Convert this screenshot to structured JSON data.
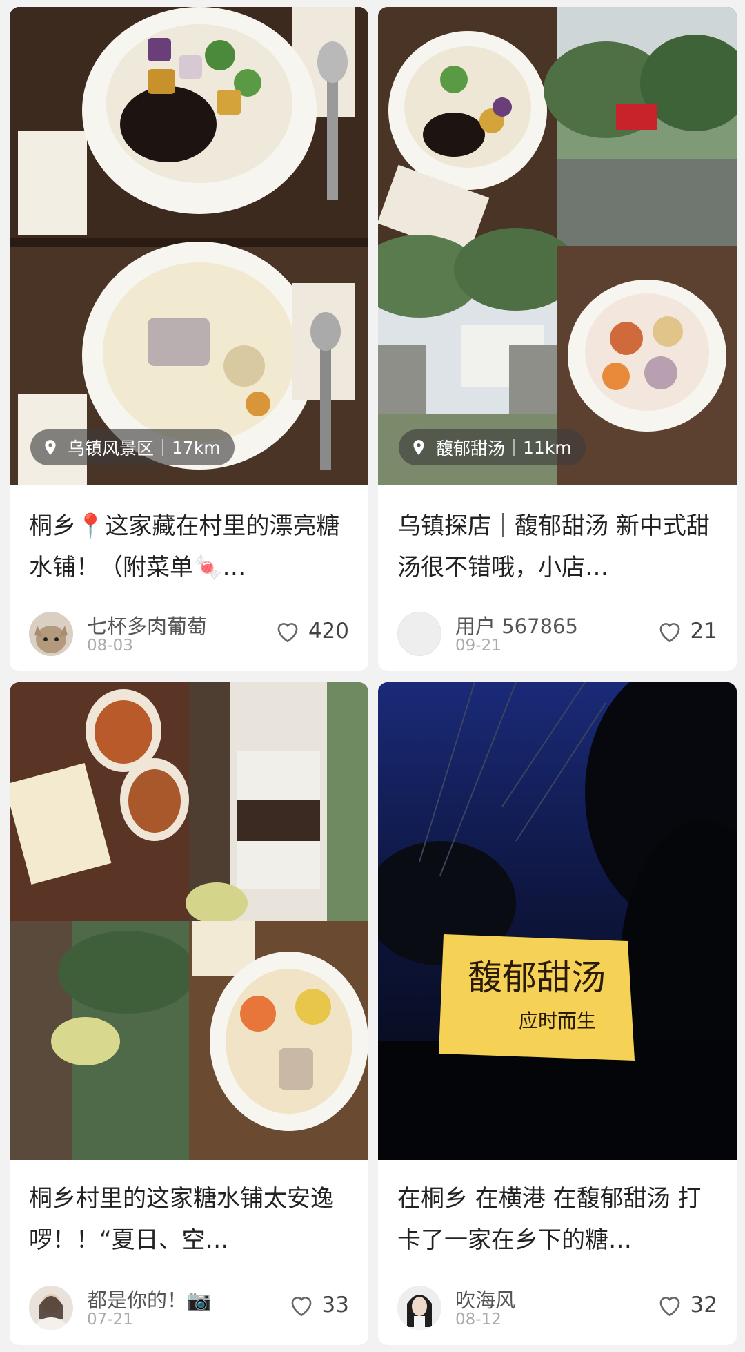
{
  "cards": [
    {
      "location": "乌镇风景区",
      "distance": "17km",
      "title": "桐乡📍这家藏在村里的漂亮糖水铺！（附菜单🍬…",
      "author": "七杯多肉葡萄",
      "date": "08-03",
      "likes": "420"
    },
    {
      "location": "馥郁甜汤",
      "distance": "11km",
      "title": "乌镇探店｜馥郁甜汤 新中式甜汤很不错哦，小店…",
      "author": "用户 567865",
      "date": "09-21",
      "likes": "21"
    },
    {
      "title": "桐乡村里的这家糖水铺太安逸啰！！“夏日、空…",
      "author": "都是你的！📷",
      "date": "07-21",
      "likes": "33"
    },
    {
      "title": "在桐乡 在横港 在馥郁甜汤 打卡了一家在乡下的糖…",
      "author": "吹海风",
      "date": "08-12",
      "likes": "32",
      "sign_text_main": "馥郁甜汤",
      "sign_text_sub": "应时而生"
    }
  ],
  "colors": {
    "background": "#f2f2f2",
    "card": "#ffffff",
    "badge": "#3c3c3c"
  },
  "icons": [
    "location-pin-icon",
    "heart-outline-icon"
  ]
}
